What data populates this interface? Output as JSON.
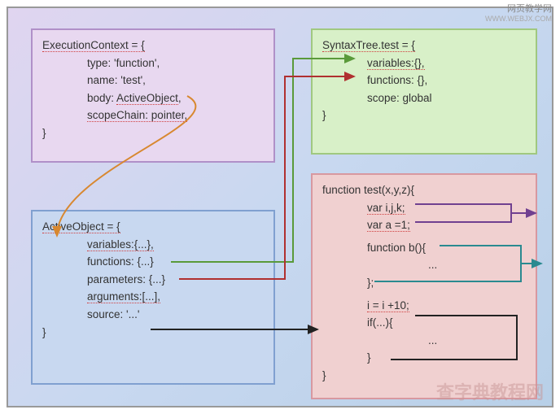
{
  "watermark": {
    "title": "网页教学网",
    "url": "WWW.WEBJX.COM",
    "bottom": "查字典教程网"
  },
  "execContext": {
    "header": "ExecutionContext = {",
    "type": "type: 'function',",
    "name": "name: 'test',",
    "bodyLabel": "body:",
    "bodyValue": "ActiveObject",
    "bodyComma": ",",
    "scopeChain": "scopeChain: pointer,",
    "close": "}"
  },
  "syntaxTree": {
    "header": "SyntaxTree.test = {",
    "variables": "variables:{},",
    "functions": "functions: {},",
    "scope": "scope: global",
    "close": "}"
  },
  "activeObject": {
    "header": "ActiveObject = {",
    "variables": "variables:{...},",
    "functions": "functions: {...}",
    "parameters": "parameters: {...}",
    "arguments": "arguments:[...],",
    "source": "source: '...'",
    "close": "}"
  },
  "funcTest": {
    "header": "function test(x,y,z){",
    "varDecl": "var i,j,k;",
    "varA": "var a =1;",
    "fnB": "function b(){",
    "dots1": "...",
    "fnBClose": "};",
    "iexpr": "i = i +10;",
    "ifexpr": "if(...){",
    "dots2": "...",
    "ifClose": "}",
    "close": "}"
  }
}
